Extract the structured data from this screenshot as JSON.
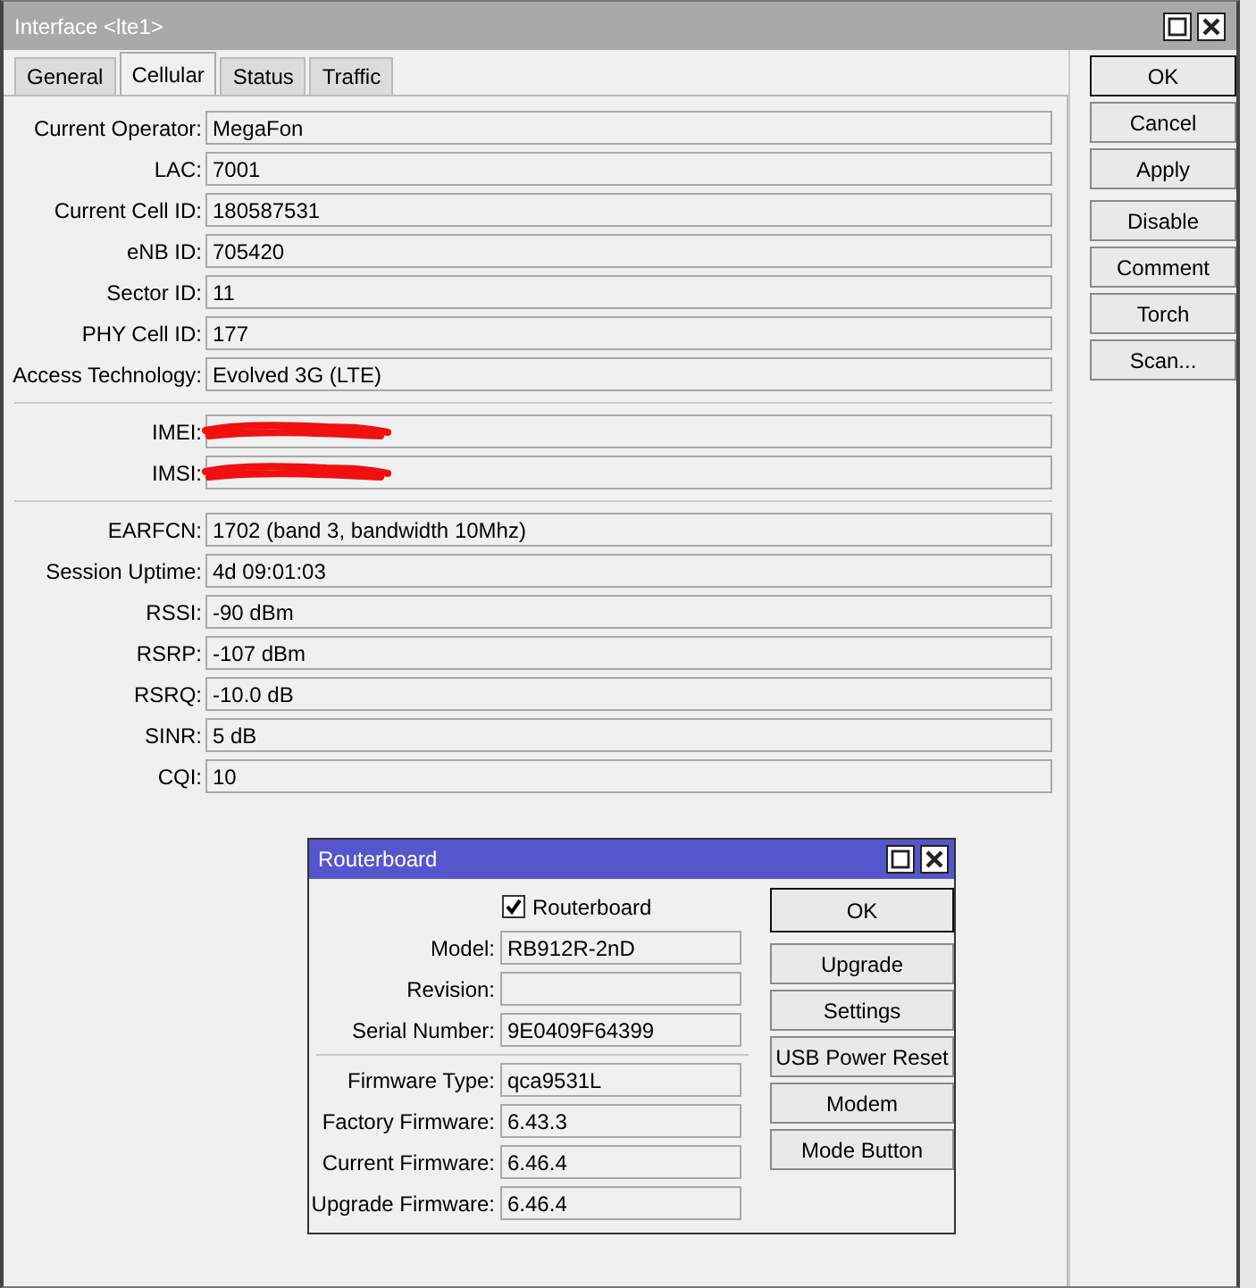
{
  "window": {
    "title": "Interface <lte1>"
  },
  "tabs": [
    {
      "label": "General",
      "selected": false
    },
    {
      "label": "Cellular",
      "selected": true
    },
    {
      "label": "Status",
      "selected": false
    },
    {
      "label": "Traffic",
      "selected": false
    }
  ],
  "field_groups": [
    [
      {
        "label": "Current Operator:",
        "value": "MegaFon"
      },
      {
        "label": "LAC:",
        "value": "7001"
      },
      {
        "label": "Current Cell ID:",
        "value": "180587531"
      },
      {
        "label": "eNB ID:",
        "value": "705420"
      },
      {
        "label": "Sector ID:",
        "value": "11"
      },
      {
        "label": "PHY Cell ID:",
        "value": "177"
      },
      {
        "label": "Access Technology:",
        "value": "Evolved 3G (LTE)"
      }
    ],
    [
      {
        "label": "IMEI:",
        "redacted": true
      },
      {
        "label": "IMSI:",
        "redacted": true
      }
    ],
    [
      {
        "label": "EARFCN:",
        "value": "1702 (band 3, bandwidth 10Mhz)"
      },
      {
        "label": "Session Uptime:",
        "value": "4d 09:01:03"
      },
      {
        "label": "RSSI:",
        "value": "-90 dBm"
      },
      {
        "label": "RSRP:",
        "value": "-107 dBm"
      },
      {
        "label": "RSRQ:",
        "value": "-10.0 dB"
      },
      {
        "label": "SINR:",
        "value": "5 dB"
      },
      {
        "label": "CQI:",
        "value": "10"
      }
    ]
  ],
  "buttons": [
    [
      {
        "label": "OK",
        "default": true
      },
      {
        "label": "Cancel",
        "default": false
      },
      {
        "label": "Apply",
        "default": false
      }
    ],
    [
      {
        "label": "Disable",
        "default": false
      },
      {
        "label": "Comment",
        "default": false
      },
      {
        "label": "Torch",
        "default": false
      },
      {
        "label": "Scan...",
        "default": false
      }
    ]
  ],
  "dialog": {
    "title": "Routerboard",
    "checkbox": {
      "label": "Routerboard",
      "checked": true
    },
    "field_groups": [
      [
        {
          "label": "Model:",
          "value": "RB912R-2nD"
        },
        {
          "label": "Revision:"
        },
        {
          "label": "Serial Number:",
          "value": "9E0409F64399"
        }
      ],
      [
        {
          "label": "Firmware Type:",
          "value": "qca9531L"
        },
        {
          "label": "Factory Firmware:",
          "value": "6.43.3"
        },
        {
          "label": "Current Firmware:",
          "value": "6.46.4"
        },
        {
          "label": "Upgrade Firmware:",
          "value": "6.46.4"
        }
      ]
    ],
    "buttons": [
      [
        {
          "label": "OK",
          "default": true
        }
      ],
      [
        {
          "label": "Upgrade",
          "default": false
        },
        {
          "label": "Settings",
          "default": false
        },
        {
          "label": "USB Power Reset",
          "default": false
        },
        {
          "label": "Modem",
          "default": false
        },
        {
          "label": "Mode Button",
          "default": false
        }
      ]
    ]
  }
}
